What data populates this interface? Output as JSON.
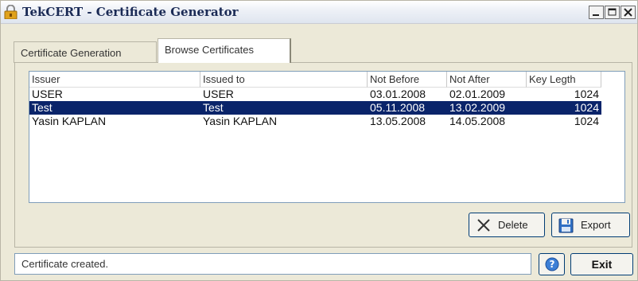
{
  "window": {
    "title": "TekCERT - Certificate Generator"
  },
  "tabs": [
    {
      "label": "Certificate Generation"
    },
    {
      "label": "Browse Certificates"
    }
  ],
  "list": {
    "columns": [
      "Issuer",
      "Issued to",
      "Not Before",
      "Not After",
      "Key Legth"
    ],
    "rows": [
      {
        "issuer": "USER",
        "issued_to": "USER",
        "not_before": "03.01.2008",
        "not_after": "02.01.2009",
        "key_length": "1024",
        "selected": false
      },
      {
        "issuer": "Test",
        "issued_to": "Test",
        "not_before": "05.11.2008",
        "not_after": "13.02.2009",
        "key_length": "1024",
        "selected": true
      },
      {
        "issuer": "Yasin KAPLAN",
        "issued_to": "Yasin KAPLAN",
        "not_before": "13.05.2008",
        "not_after": "14.05.2008",
        "key_length": "1024",
        "selected": false
      }
    ]
  },
  "buttons": {
    "delete_label": "Delete",
    "export_label": "Export",
    "exit_label": "Exit"
  },
  "status": {
    "text": "Certificate created."
  },
  "colors": {
    "selection": "#0a246a",
    "title_text": "#1a2a55"
  }
}
